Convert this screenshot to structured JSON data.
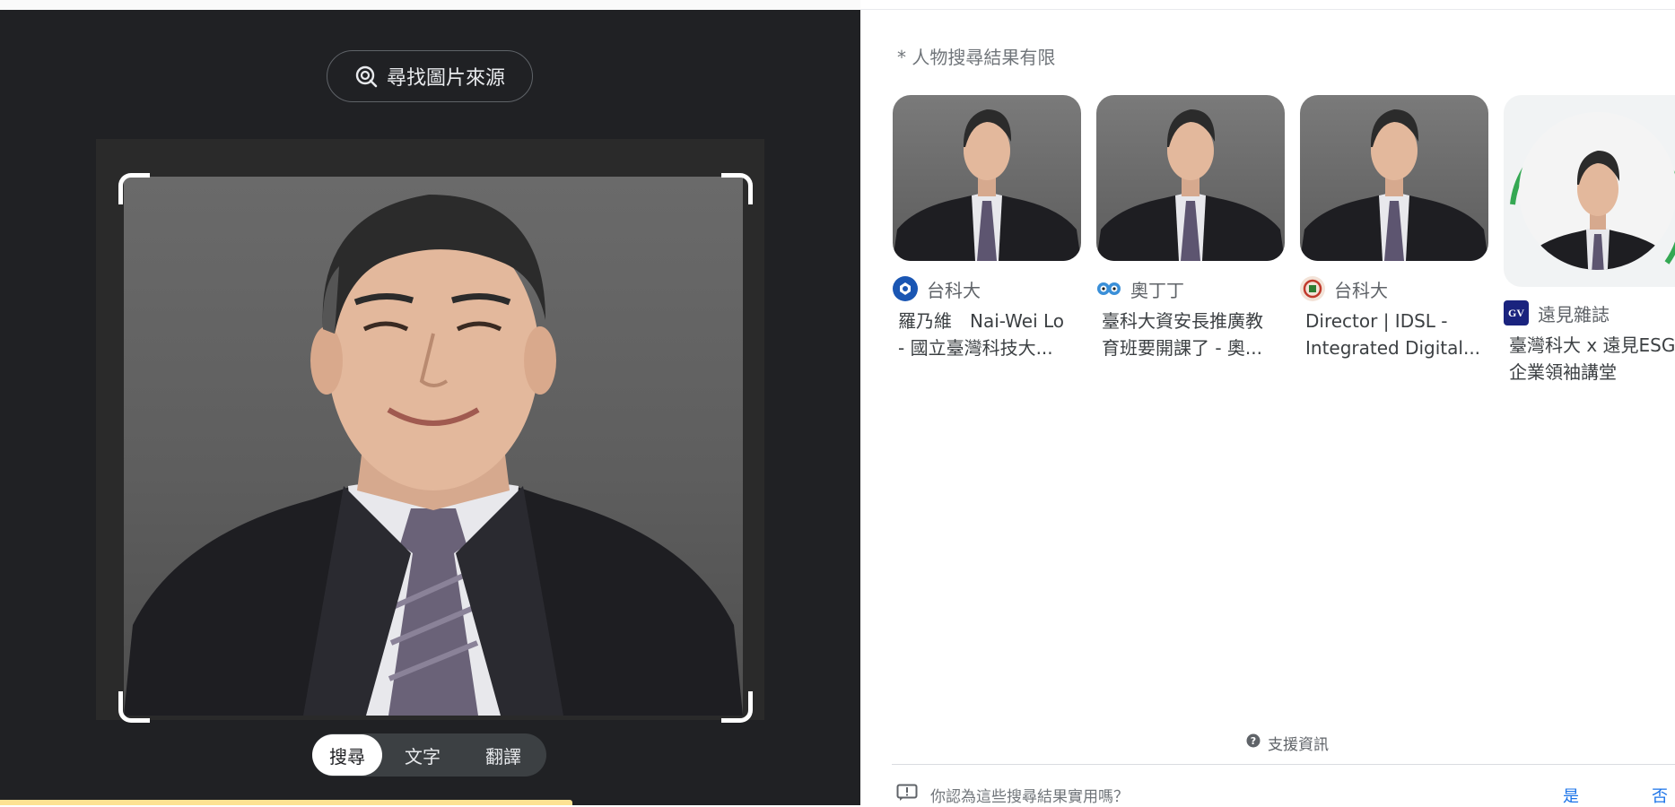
{
  "lens": {
    "find_source_label": "尋找圖片來源",
    "tabs": [
      {
        "label": "搜尋",
        "active": true
      },
      {
        "label": "文字",
        "active": false
      },
      {
        "label": "翻譯",
        "active": false
      }
    ]
  },
  "results": {
    "notice": "* 人物搜尋結果有限",
    "cards": [
      {
        "source": "台科大",
        "title_lines": [
          "羅乃維　Nai-Wei Lo",
          "- 國立臺灣科技大..."
        ],
        "favicon": "ntust-logo-icon"
      },
      {
        "source": "奧丁丁",
        "title_lines": [
          "臺科大資安長推廣教",
          "育班要開課了 - 奧..."
        ],
        "favicon": "owl-icon"
      },
      {
        "source": "台科大",
        "title_lines": [
          "Director | IDSL -",
          "Integrated Digital..."
        ],
        "favicon": "idsl-logo-icon"
      },
      {
        "source": "遠見雜誌",
        "title_lines": [
          "臺灣科大 x 遠見ESG",
          "企業領袖講堂"
        ],
        "favicon": "gv-logo-icon"
      }
    ],
    "support_label": "支援資訊",
    "feedback_question": "你認為這些搜尋結果實用嗎？",
    "yes_label": "是",
    "no_label": "否"
  },
  "colors": {
    "dark_bg": "#202124",
    "accent_blue": "#1a73e8",
    "highlight_yellow": "#fde293",
    "ring_green": "#34a853"
  }
}
